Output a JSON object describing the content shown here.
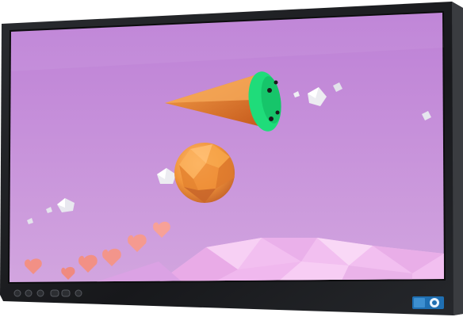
{
  "monitor": {
    "bezel_color": "#1c1d20",
    "bezel_edge_color": "#3a3c40",
    "screen_top_color": "#bd80d6",
    "screen_bottom_color": "#d2a5df",
    "buttons": [
      {
        "name": "power",
        "icon": "power-icon"
      },
      {
        "name": "menu",
        "icon": "menu-icon"
      },
      {
        "name": "left",
        "icon": "left-icon"
      },
      {
        "name": "right",
        "icon": "right-icon"
      },
      {
        "name": "input",
        "icon": "input-icon"
      },
      {
        "name": "auto",
        "icon": "auto-icon"
      }
    ],
    "logo": {
      "color": "#1f6fb2",
      "icon": "eco-logo-icon"
    }
  },
  "scene": {
    "rocket": {
      "cone_color": "#e97a2b",
      "cap_color": "#1fdc7a"
    },
    "planet": {
      "color": "#f29a3a"
    },
    "hearts_color": "#f7a197",
    "floor_color": "#f2bff0",
    "crystal_color": "#ececf1"
  }
}
